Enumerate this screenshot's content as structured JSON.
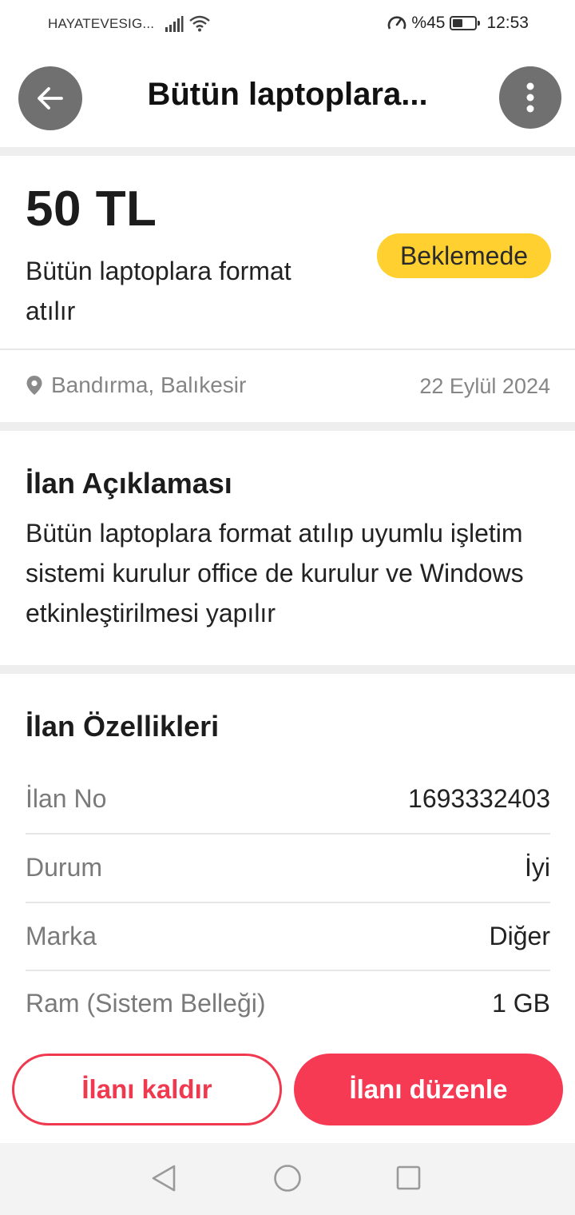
{
  "status_bar": {
    "carrier": "HAYATEVESIG...",
    "battery_text": "%45",
    "battery_level": 0.45,
    "time": "12:53"
  },
  "app_bar": {
    "title": "Bütün laptoplara...",
    "back_icon": "arrow-left-icon",
    "more_icon": "more-vertical-icon"
  },
  "listing": {
    "price": "50 TL",
    "subtitle": "Bütün laptoplara format atılır",
    "status_badge": "Beklemede",
    "location": "Bandırma, Balıkesir",
    "date": "22 Eylül 2024"
  },
  "description": {
    "title": "İlan Açıklaması",
    "text": "Bütün laptoplara format atılıp uyumlu işletim sistemi kurulur office de kurulur ve Windows etkinleştirilmesi yapılır"
  },
  "properties": {
    "title": "İlan Özellikleri",
    "rows": [
      {
        "key": "İlan No",
        "value": "1693332403"
      },
      {
        "key": "Durum",
        "value": "İyi"
      },
      {
        "key": "Marka",
        "value": "Diğer"
      },
      {
        "key": "Ram (Sistem Belleği)",
        "value": "1 GB"
      }
    ]
  },
  "actions": {
    "remove_label": "İlanı kaldır",
    "edit_label": "İlanı düzenle"
  },
  "colors": {
    "accent": "#f63a54",
    "badge": "#ffd02f",
    "icon_button": "#707070"
  }
}
